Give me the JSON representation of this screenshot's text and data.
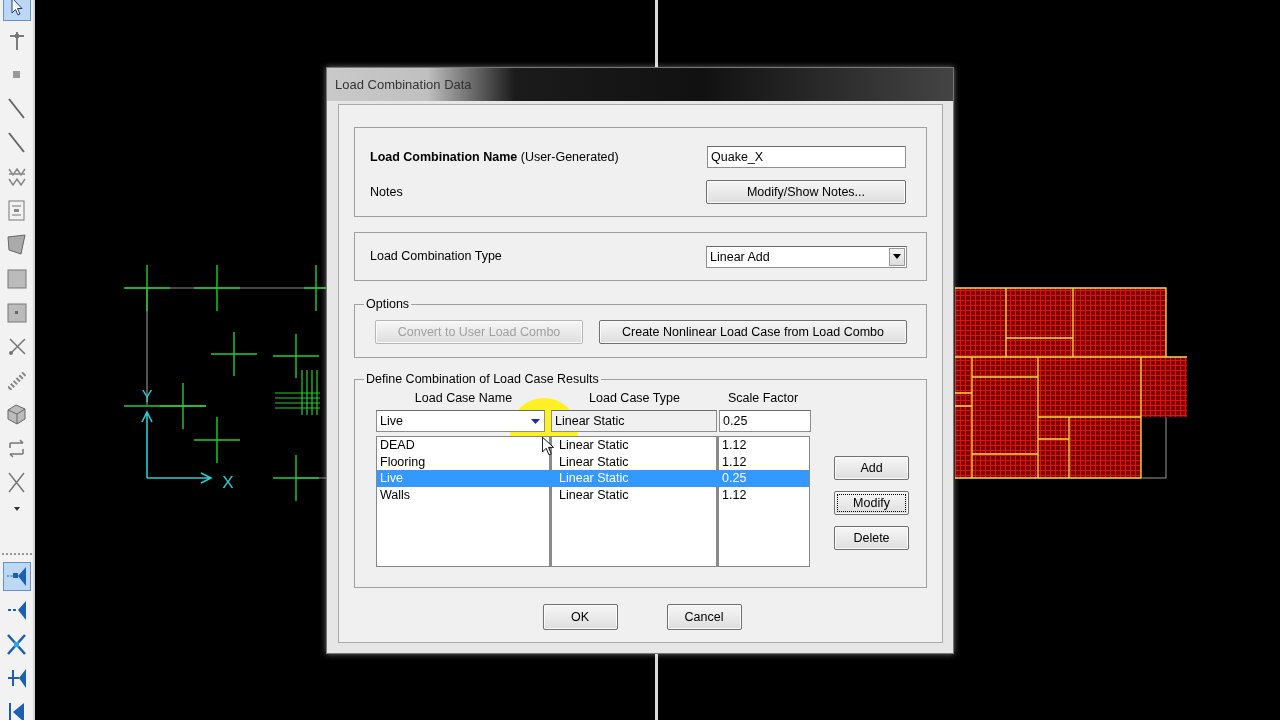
{
  "toolbar": {
    "groups": [
      {
        "tools": [
          {
            "kind": "pointer",
            "selected": true
          },
          {
            "kind": "reshaper",
            "selected": false
          },
          {
            "kind": "point",
            "selected": false
          },
          {
            "kind": "line",
            "selected": false
          },
          {
            "kind": "line",
            "selected": false
          },
          {
            "kind": "zigzag",
            "selected": false
          },
          {
            "kind": "framebox",
            "selected": false
          },
          {
            "kind": "quad",
            "selected": false
          },
          {
            "kind": "square",
            "selected": false
          },
          {
            "kind": "squaredot",
            "selected": false
          },
          {
            "kind": "link",
            "selected": false
          },
          {
            "kind": "spring",
            "selected": false
          },
          {
            "kind": "solid",
            "selected": false
          },
          {
            "kind": "loop",
            "selected": false
          },
          {
            "kind": "cross",
            "selected": false
          },
          {
            "kind": "more",
            "selected": false
          }
        ]
      },
      {
        "tools": [
          {
            "kind": "snap-point",
            "selected": true
          },
          {
            "kind": "snap-mid",
            "selected": false
          },
          {
            "kind": "snap-intersect",
            "selected": false
          },
          {
            "kind": "snap-perp",
            "selected": false
          },
          {
            "kind": "snap-end",
            "selected": false
          }
        ]
      }
    ]
  },
  "left_view": {
    "axis_labels": {
      "x": "X",
      "y": "Y"
    }
  },
  "dialog": {
    "title": "Load Combination Data",
    "name_section": {
      "label": "Load Combination Name",
      "note": "(User-Generated)",
      "value": "Quake_X",
      "notes_label": "Notes",
      "notes_button": "Modify/Show Notes..."
    },
    "type_section": {
      "label": "Load Combination Type",
      "value": "Linear Add"
    },
    "options": {
      "title": "Options",
      "buttons": [
        {
          "label": "Convert to User Load Combo",
          "disabled": true
        },
        {
          "label": "Create Nonlinear Load Case from Load Combo",
          "disabled": false
        }
      ]
    },
    "define": {
      "title": "Define Combination of Load Case Results",
      "columns": [
        "Load Case Name",
        "Load Case Type",
        "Scale Factor"
      ],
      "editor": {
        "name": "Live",
        "type": "Linear Static",
        "factor": "0.25"
      },
      "rows": [
        {
          "name": "DEAD",
          "type": "Linear Static",
          "factor": "1.12",
          "selected": false
        },
        {
          "name": "Flooring",
          "type": "Linear Static",
          "factor": "1.12",
          "selected": false
        },
        {
          "name": "Live",
          "type": "Linear Static",
          "factor": "0.25",
          "selected": true
        },
        {
          "name": "Walls",
          "type": "Linear Static",
          "factor": "1.12",
          "selected": false
        }
      ],
      "buttons": [
        {
          "label": "Add",
          "focused": false
        },
        {
          "label": "Modify",
          "focused": true
        },
        {
          "label": "Delete",
          "focused": false
        }
      ]
    },
    "footer_buttons": [
      "OK",
      "Cancel"
    ]
  }
}
